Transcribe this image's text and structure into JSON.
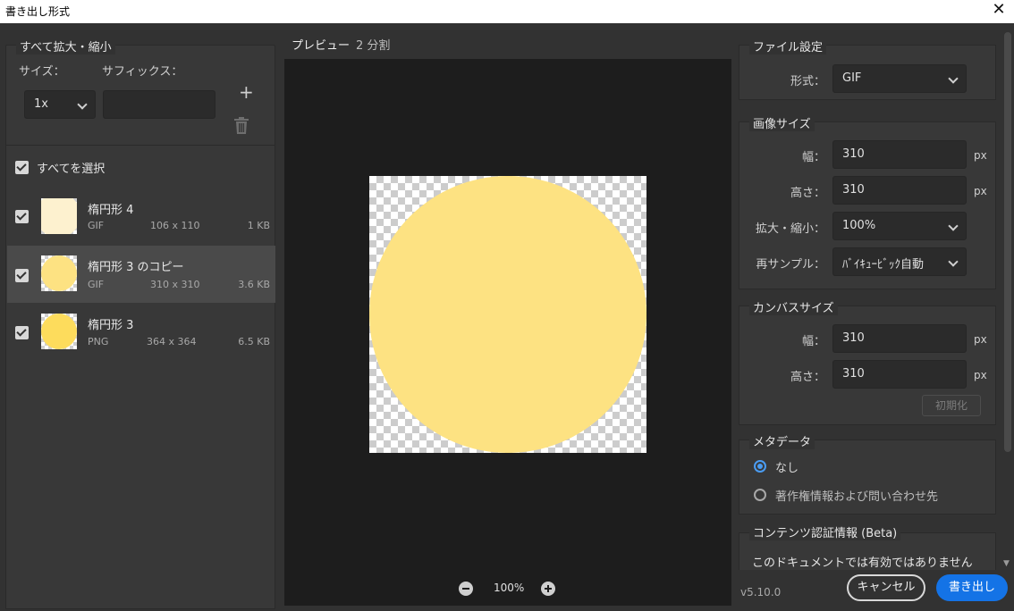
{
  "window": {
    "title": "書き出し形式",
    "close_glyph": "✕"
  },
  "scale": {
    "title": "すべて拡大・縮小",
    "size_label": "サイズ：",
    "suffix_label": "サフィックス：",
    "add_glyph": "+",
    "size_value": "1x",
    "suffix_value": ""
  },
  "assets": {
    "select_all": "すべてを選択",
    "items": [
      {
        "name": "楕円形 4",
        "format": "GIF",
        "dimensions": "106 x 110",
        "size": "1 KB",
        "checked": true,
        "color": "#fdf1cf"
      },
      {
        "name": "楕円形 3 のコピー",
        "format": "GIF",
        "dimensions": "310 x 310",
        "size": "3.6 KB",
        "checked": true,
        "color": "#fde282"
      },
      {
        "name": "楕円形 3",
        "format": "PNG",
        "dimensions": "364 x 364",
        "size": "6.5 KB",
        "checked": true,
        "color": "#fddc5c"
      }
    ]
  },
  "preview": {
    "tabs": [
      "プレビュー",
      "2 分割"
    ],
    "active_tab": 0,
    "zoom": "100%",
    "fill_color": "#fde282"
  },
  "file_settings": {
    "title": "ファイル設定",
    "format_label": "形式：",
    "format_value": "GIF"
  },
  "image_size": {
    "title": "画像サイズ",
    "width_label": "幅：",
    "width_value": "310",
    "height_label": "高さ：",
    "height_value": "310",
    "unit": "px",
    "scale_label": "拡大・縮小：",
    "scale_value": "100%",
    "resample_label": "再サンプル：",
    "resample_value": "ﾊﾞｲｷｭｰﾋﾞｯｸ自動"
  },
  "canvas_size": {
    "title": "カンバスサイズ",
    "width_label": "幅：",
    "width_value": "310",
    "height_label": "高さ：",
    "height_value": "310",
    "unit": "px",
    "reset_label": "初期化"
  },
  "metadata": {
    "title": "メタデータ",
    "options": [
      "なし",
      "著作権情報および問い合わせ先"
    ],
    "selected": 0
  },
  "content_credentials": {
    "title": "コンテンツ認証情報 (Beta)",
    "message": "このドキュメントでは有効ではありません"
  },
  "footer": {
    "version": "v5.10.0",
    "cancel_label": "キャンセル",
    "export_label": "書き出し"
  },
  "colors": {
    "accent": "#1473e6",
    "radio": "#4a9cf2"
  }
}
